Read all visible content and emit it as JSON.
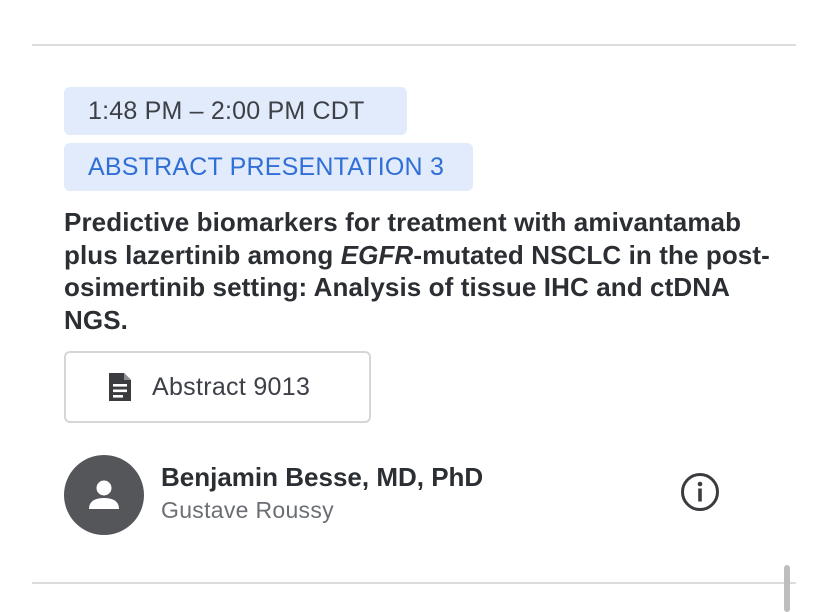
{
  "session": {
    "time": "1:48 PM – 2:00 PM CDT",
    "type": "ABSTRACT PRESENTATION 3",
    "title_part1": "Predictive biomarkers for treatment with amivantamab plus lazertinib among ",
    "title_italic": "EGFR",
    "title_part2": "-mutated NSCLC in the post-osimertinib setting: Analysis of tissue IHC and ctDNA NGS.",
    "abstract_button_label": "Abstract 9013",
    "abstract_icon": "document-icon"
  },
  "speaker": {
    "name": "Benjamin Besse, MD, PhD",
    "affiliation": "Gustave Roussy",
    "avatar_icon": "person-icon",
    "info_icon": "info-icon"
  },
  "colors": {
    "chip_background": "#e1ebfb",
    "chip_accent_text": "#2f6fd6",
    "avatar_background": "#545659",
    "divider": "#dcdcdc"
  }
}
